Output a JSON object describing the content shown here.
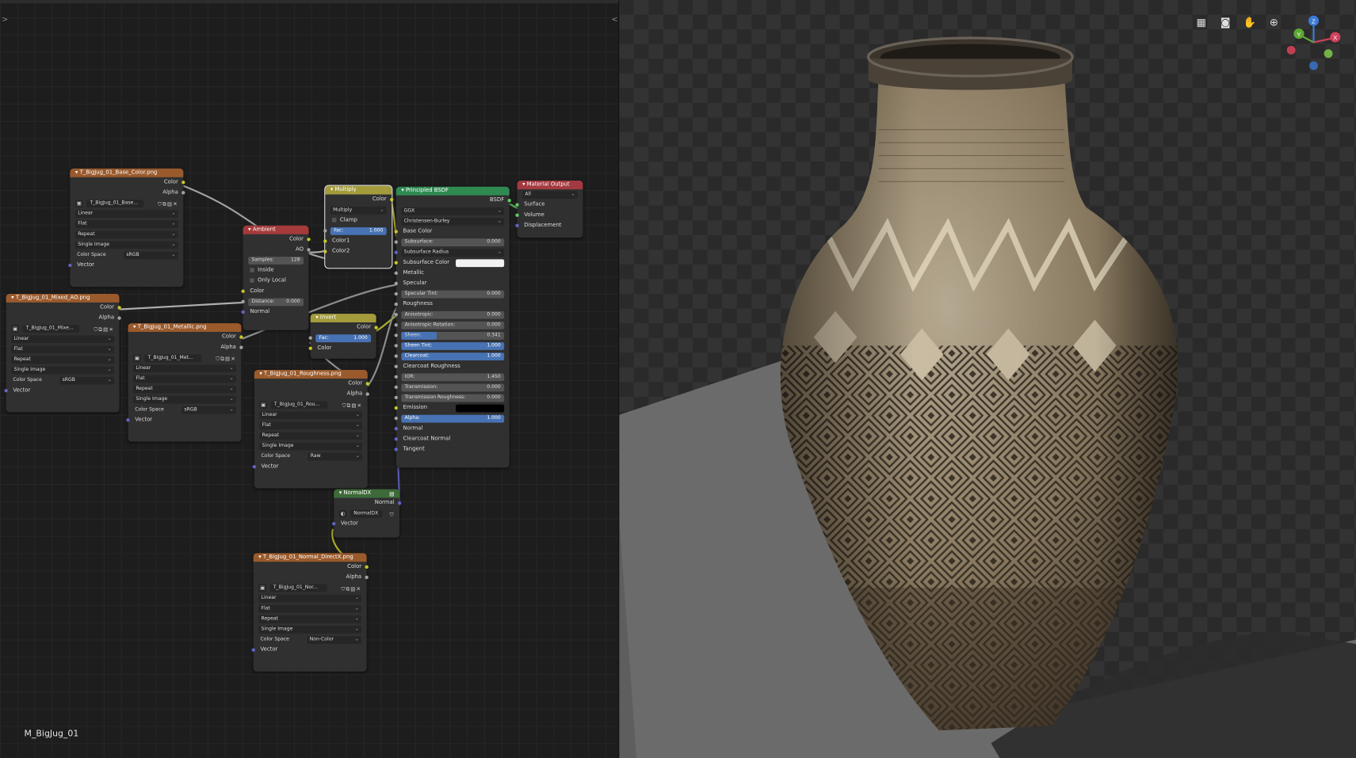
{
  "material_name": "M_BigJug_01",
  "nodes": {
    "base_color_tex": {
      "title": "T_BigJug_01_Base_Color.png",
      "outputs": [
        "Color",
        "Alpha"
      ],
      "image_name": "T_BigJug_01_Base...",
      "interpolation": "Linear",
      "projection": "Flat",
      "extension": "Repeat",
      "source": "Single Image",
      "color_space_label": "Color Space",
      "color_space": "sRGB",
      "vector_label": "Vector"
    },
    "mixed_ao_tex": {
      "title": "T_BigJug_01_Mixed_AO.png",
      "outputs": [
        "Color",
        "Alpha"
      ],
      "image_name": "T_BigJug_01_Mixe...",
      "interpolation": "Linear",
      "projection": "Flat",
      "extension": "Repeat",
      "source": "Single Image",
      "color_space_label": "Color Space",
      "color_space": "sRGB",
      "vector_label": "Vector"
    },
    "metallic_tex": {
      "title": "T_BigJug_01_Metallic.png",
      "outputs": [
        "Color",
        "Alpha"
      ],
      "image_name": "T_BigJug_01_Met...",
      "interpolation": "Linear",
      "projection": "Flat",
      "extension": "Repeat",
      "source": "Single Image",
      "color_space_label": "Color Space",
      "color_space": "sRGB",
      "vector_label": "Vector"
    },
    "roughness_tex": {
      "title": "T_BigJug_01_Roughness.png",
      "outputs": [
        "Color",
        "Alpha"
      ],
      "image_name": "T_BigJug_01_Rou...",
      "interpolation": "Linear",
      "projection": "Flat",
      "extension": "Repeat",
      "source": "Single Image",
      "color_space_label": "Color Space",
      "color_space": "Raw",
      "vector_label": "Vector"
    },
    "normal_tex": {
      "title": "T_BigJug_01_Normal_DirectX.png",
      "outputs": [
        "Color",
        "Alpha"
      ],
      "image_name": "T_BigJug_01_Nor...",
      "interpolation": "Linear",
      "projection": "Flat",
      "extension": "Repeat",
      "source": "Single Image",
      "color_space_label": "Color Space",
      "color_space": "Non-Color",
      "vector_label": "Vector"
    },
    "ambient": {
      "title": "Ambient",
      "outputs": [
        "Color",
        "AO"
      ],
      "samples_label": "Samples:",
      "samples": "128",
      "inside": "Inside",
      "only_local": "Only Local",
      "inputs": [
        "Color"
      ],
      "distance_label": "Distance:",
      "distance": "0.000",
      "normal": "Normal"
    },
    "multiply": {
      "title": "Multiply",
      "output": "Color",
      "blend": "Multiply",
      "clamp": "Clamp",
      "fac_label": "Fac:",
      "fac": "1.000",
      "inputs": [
        "Color1",
        "Color2"
      ]
    },
    "invert": {
      "title": "Invert",
      "output": "Color",
      "fac_label": "Fac:",
      "fac": "1.000",
      "input": "Color"
    },
    "normaldx": {
      "title": "NormalDX",
      "output": "Normal",
      "group_name": "NormalDX",
      "input": "Vector"
    },
    "bsdf": {
      "title": "Principled BSDF",
      "output": "BSDF",
      "distribution": "GGX",
      "subsurface_method": "Christensen-Burley",
      "base_color": "Base Color",
      "subsurface_label": "Subsurface:",
      "subsurface": "0.000",
      "subsurface_radius": "Subsurface Radius",
      "subsurface_color": "Subsurface Color",
      "metallic": "Metallic",
      "specular": "Specular",
      "specular_tint_label": "Specular Tint:",
      "specular_tint": "0.000",
      "roughness": "Roughness",
      "anisotropic_label": "Anisotropic:",
      "anisotropic": "0.000",
      "anisotropic_rotation_label": "Anisotropic Rotation:",
      "anisotropic_rotation": "0.000",
      "sheen_label": "Sheen:",
      "sheen": "0.341",
      "sheen_fraction": 0.341,
      "sheen_tint_label": "Sheen Tint:",
      "sheen_tint": "1.000",
      "clearcoat_label": "Clearcoat:",
      "clearcoat": "1.000",
      "clearcoat_roughness": "Clearcoat Roughness",
      "ior_label": "IOR:",
      "ior": "1.450",
      "transmission_label": "Transmission:",
      "transmission": "0.000",
      "transmission_roughness_label": "Transmission Roughness:",
      "transmission_roughness": "0.000",
      "emission": "Emission",
      "alpha_label": "Alpha:",
      "alpha": "1.000",
      "normal": "Normal",
      "clearcoat_normal": "Clearcoat Normal",
      "tangent": "Tangent"
    },
    "material_output": {
      "title": "Material Output",
      "target": "All",
      "inputs": [
        "Surface",
        "Volume",
        "Displacement"
      ]
    }
  },
  "viewport": {
    "gizmo": {
      "x": "X",
      "y": "Y",
      "z": "Z"
    },
    "icons": [
      "grid-icon",
      "camera-icon",
      "hand-icon",
      "zoom-icon"
    ]
  },
  "colors": {
    "texture_header": "#9a5a2c",
    "converter_header": "#a43a3a",
    "color_header": "#a39b3c",
    "shader_header": "#2f8a52",
    "group_header": "#3d6a38",
    "accent_blue": "#4772b3"
  }
}
